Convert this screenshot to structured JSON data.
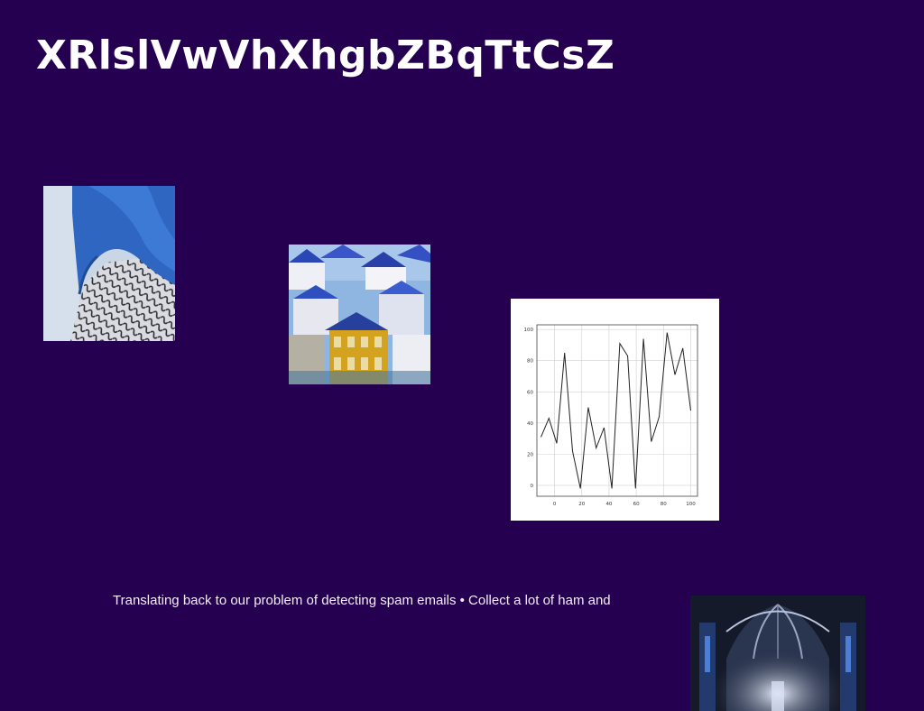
{
  "slide": {
    "title": "XRlslVwVhXhgbZBqTtCsZ",
    "body": "Translating back to our problem of detecting spam emails • Collect a lot of ham and"
  },
  "colors": {
    "background": "#250050",
    "title": "#ffffff",
    "body_text": "#f2eef8"
  },
  "images": [
    {
      "name": "scarf-photo"
    },
    {
      "name": "rooftops-photo"
    },
    {
      "name": "line-chart-image"
    },
    {
      "name": "cathedral-photo"
    }
  ],
  "chart_data": {
    "type": "line",
    "x": [
      -10,
      -4,
      2,
      8,
      14,
      20,
      26,
      32,
      38,
      44,
      50,
      56,
      62,
      68,
      74,
      80,
      86,
      92,
      100
    ],
    "series": [
      {
        "values": [
          31,
          43,
          27,
          85,
          22,
          -2,
          50,
          24,
          37,
          -2,
          91,
          83,
          -2,
          94,
          28,
          44,
          98,
          71,
          88,
          48
        ]
      }
    ],
    "xticks": [
      "0",
      "20",
      "40",
      "60",
      "80",
      "100"
    ],
    "yticks": [
      "0",
      "20",
      "40",
      "60",
      "80",
      "100"
    ],
    "xlim": [
      -13,
      105
    ],
    "ylim": [
      -7,
      103
    ],
    "grid": true
  }
}
